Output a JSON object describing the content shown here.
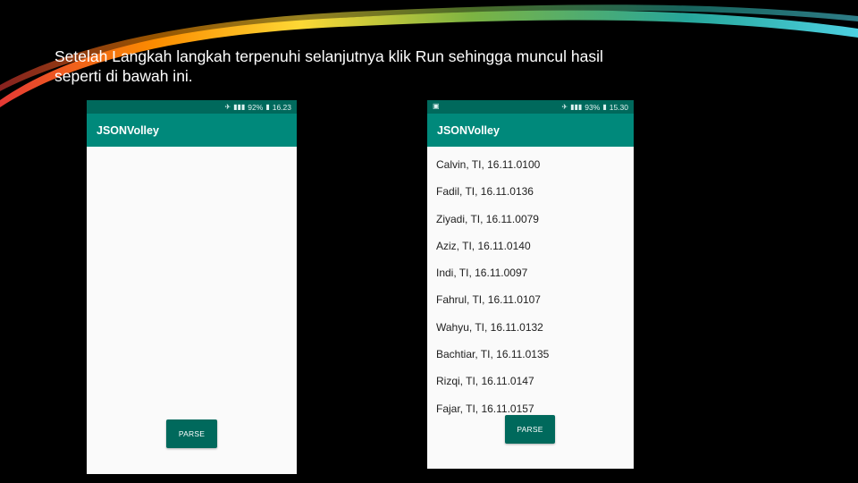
{
  "slide": {
    "caption_line1": "Setelah Langkah langkah terpenuhi selanjutnya klik Run sehingga muncul hasil",
    "caption_line2": "seperti di bawah ini."
  },
  "phone_before": {
    "status_time": "16.23",
    "status_battery": "92%",
    "app_title": "JSONVolley",
    "parse_label": "PARSE"
  },
  "phone_after": {
    "status_time": "15.30",
    "status_battery": "93%",
    "app_title": "JSONVolley",
    "parse_label": "PARSE",
    "items": [
      "Calvin, TI, 16.11.0100",
      "Fadil, TI, 16.11.0136",
      "Ziyadi, TI, 16.11.0079",
      "Aziz, TI, 16.11.0140",
      "Indi, TI, 16.11.0097",
      "Fahrul, TI, 16.11.0107",
      "Wahyu, TI, 16.11.0132",
      "Bachtiar, TI, 16.11.0135",
      "Rizqi, TI, 16.11.0147",
      "Fajar, TI, 16.11.0157"
    ]
  },
  "colors": {
    "primary": "#00897b",
    "primary_dark": "#00695c"
  }
}
